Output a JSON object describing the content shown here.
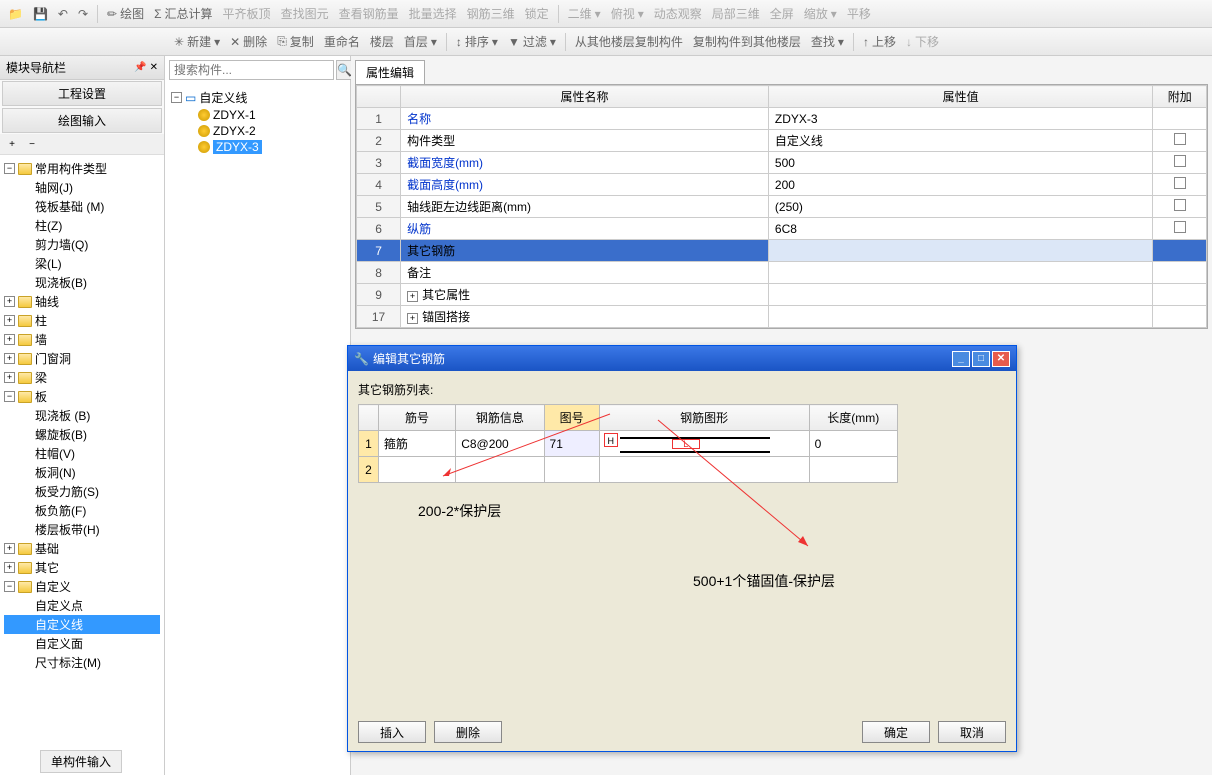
{
  "toolbar1": {
    "draw": "绘图",
    "summary": "汇总计算",
    "flat_top": "平齐板顶",
    "find_elem": "查找图元",
    "view_rebar": "查看钢筋量",
    "batch_sel": "批量选择",
    "rebar_3d": "钢筋三维",
    "lock": "锁定",
    "view2d": "二维",
    "persp": "俯视",
    "dynamic": "动态观察",
    "local3d": "局部三维",
    "full": "全屏",
    "zoom": "缩放",
    "flat": "平移"
  },
  "toolbar2": {
    "new": "新建",
    "delete": "删除",
    "copy": "复制",
    "rename": "重命名",
    "floor": "楼层",
    "first_floor": "首层",
    "sort": "排序",
    "filter": "过滤",
    "copy_from": "从其他楼层复制构件",
    "copy_to": "复制构件到其他楼层",
    "find": "查找",
    "up": "上移",
    "down": "下移"
  },
  "leftPanel": {
    "title": "模块导航栏",
    "tab1": "工程设置",
    "tab2": "绘图输入",
    "bottom_tab": "单构件输入"
  },
  "navTree": {
    "root": "常用构件类型",
    "items": [
      "轴网(J)",
      "筏板基础 (M)",
      "柱(Z)",
      "剪力墙(Q)",
      "梁(L)",
      "现浇板(B)"
    ],
    "groups": [
      "轴线",
      "柱",
      "墙",
      "门窗洞",
      "梁",
      "板",
      "基础",
      "其它",
      "自定义"
    ],
    "board_items": [
      "现浇板 (B)",
      "螺旋板(B)",
      "柱帽(V)",
      "板洞(N)",
      "板受力筋(S)",
      "板负筋(F)",
      "楼层板带(H)"
    ],
    "custom_items": [
      "自定义点",
      "自定义线",
      "自定义面",
      "尺寸标注(M)"
    ]
  },
  "midPanel": {
    "search_placeholder": "搜索构件...",
    "root": "自定义线",
    "items": [
      "ZDYX-1",
      "ZDYX-2",
      "ZDYX-3"
    ]
  },
  "propGrid": {
    "tab": "属性编辑",
    "headers": [
      "属性名称",
      "属性值",
      "附加"
    ],
    "rows": [
      {
        "n": "1",
        "name": "名称",
        "val": "ZDYX-3",
        "blue": true,
        "chk": false
      },
      {
        "n": "2",
        "name": "构件类型",
        "val": "自定义线",
        "blue": false,
        "chk": true
      },
      {
        "n": "3",
        "name": "截面宽度(mm)",
        "val": "500",
        "blue": true,
        "chk": true
      },
      {
        "n": "4",
        "name": "截面高度(mm)",
        "val": "200",
        "blue": true,
        "chk": true
      },
      {
        "n": "5",
        "name": "轴线距左边线距离(mm)",
        "val": "(250)",
        "blue": false,
        "chk": true
      },
      {
        "n": "6",
        "name": "纵筋",
        "val": "6C8",
        "blue": true,
        "chk": true
      },
      {
        "n": "7",
        "name": "其它钢筋",
        "val": "",
        "blue": false,
        "chk": false,
        "sel": true
      },
      {
        "n": "8",
        "name": "备注",
        "val": "",
        "blue": false,
        "chk": false
      },
      {
        "n": "9",
        "name": "其它属性",
        "val": "",
        "blue": false,
        "chk": false,
        "exp": true
      },
      {
        "n": "17",
        "name": "锚固搭接",
        "val": "",
        "blue": false,
        "chk": false,
        "exp": true
      }
    ]
  },
  "dialog": {
    "title": "编辑其它钢筋",
    "list_label": "其它钢筋列表:",
    "headers": [
      "筋号",
      "钢筋信息",
      "图号",
      "钢筋图形",
      "长度(mm)"
    ],
    "row1": {
      "num": "1",
      "jin": "箍筋",
      "info": "C8@200",
      "tuhao": "71",
      "len": "0",
      "H": "H",
      "L": "L"
    },
    "row2_num": "2",
    "btn_insert": "插入",
    "btn_delete": "删除",
    "btn_ok": "确定",
    "btn_cancel": "取消"
  },
  "annotations": {
    "a1": "200-2*保护层",
    "a2": "500+1个锚固值-保护层"
  }
}
